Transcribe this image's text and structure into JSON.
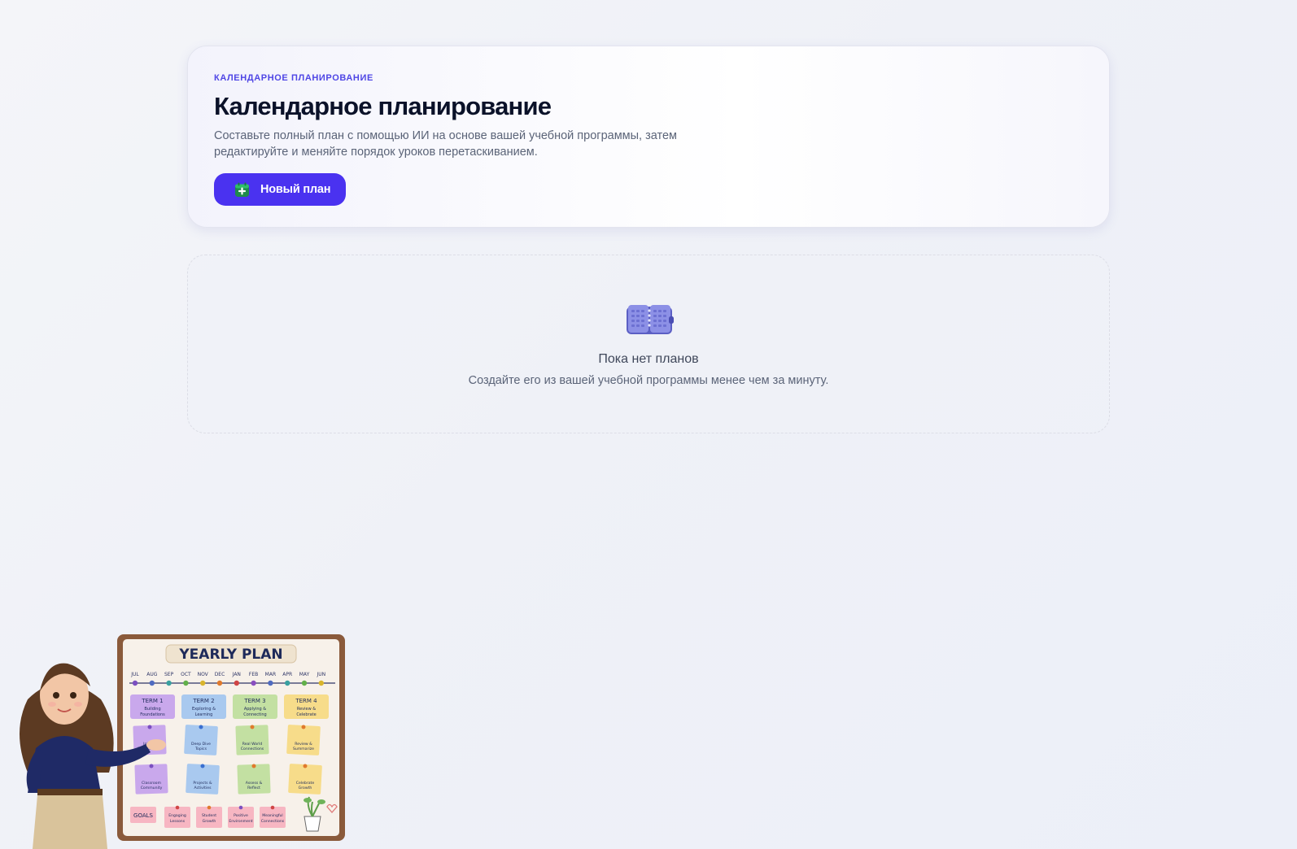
{
  "header": {
    "eyebrow": "КАЛЕНДАРНОЕ ПЛАНИРОВАНИЕ",
    "title": "Календарное планирование",
    "subtitle": "Составьте полный план с помощью ИИ на основе вашей учебной программы, затем редактируйте и меняйте порядок уроков перетаскиванием.",
    "new_plan_label": "Новый план",
    "new_plan_icon": "plus-calendar-icon"
  },
  "empty_state": {
    "icon": "planner-book-icon",
    "title": "Пока нет планов",
    "subtitle": "Создайте его из вашей учебной программы менее чем за минуту."
  },
  "illustration": {
    "board_title": "YEARLY PLAN",
    "months": [
      "JUL",
      "AUG",
      "SEP",
      "OCT",
      "NOV",
      "DEC",
      "JAN",
      "FEB",
      "MAR",
      "APR",
      "MAY",
      "JUN"
    ],
    "terms": [
      {
        "label": "TERM 1",
        "caption": "Building Foundations",
        "color": "#c9a8ec"
      },
      {
        "label": "TERM 2",
        "caption": "Exploring & Learning",
        "color": "#a9c9ef"
      },
      {
        "label": "TERM 3",
        "caption": "Applying & Connecting",
        "color": "#c3e0a2"
      },
      {
        "label": "TERM 4",
        "caption": "Review & Celebrate",
        "color": "#f7dc8a"
      }
    ],
    "notes_row1": [
      "Intro & Expectations",
      "Deep Dive Topics",
      "Real World Connections",
      "Review & Summarize"
    ],
    "notes_row2": [
      "Classroom Community",
      "Projects & Activities",
      "Assess & Reflect",
      "Celebrate Growth"
    ],
    "goals_label": "GOALS",
    "goals": [
      "Engaging Lessons",
      "Student Growth",
      "Positive Environment",
      "Meaningful Connections"
    ]
  },
  "colors": {
    "accent": "#4a32f0",
    "eyebrow": "#4f46e5",
    "title": "#0b1229",
    "muted": "#5b6478",
    "icon_add": "#22c55e",
    "planner": "#7b7fd6"
  }
}
